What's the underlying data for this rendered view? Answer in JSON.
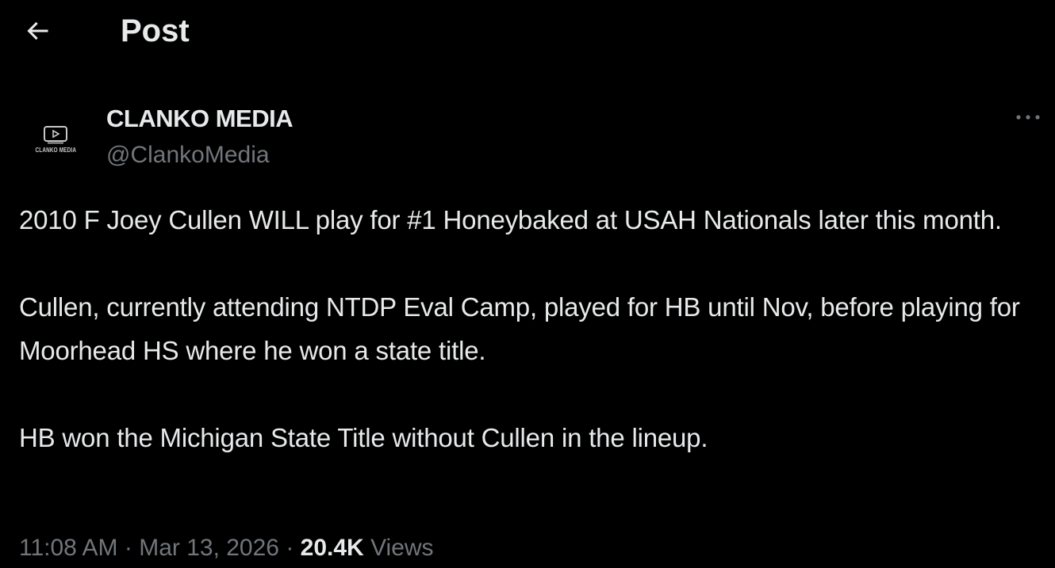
{
  "header": {
    "back_icon": "arrow-left-icon",
    "title": "Post"
  },
  "author": {
    "avatar_text": "CLANKO MEDIA",
    "display_name": "CLANKO MEDIA",
    "handle": "@ClankoMedia"
  },
  "more_icon": "more-horizontal-icon",
  "tweet": {
    "paragraphs": [
      "2010 F Joey Cullen WILL play for #1 Honeybaked at USAH Nationals later this month.",
      "Cullen, currently attending NTDP Eval Camp, played for HB until Nov, before playing for Moorhead HS where he won a state title.",
      "HB won the Michigan State Title without Cullen in the lineup."
    ]
  },
  "meta": {
    "time": "11:08 AM",
    "separator": " · ",
    "date": "Mar 13, 2026",
    "views_count": "20.4K",
    "views_label": "Views"
  },
  "colors": {
    "background": "#000000",
    "primary_text": "#e7e9ea",
    "secondary_text": "#71767b"
  }
}
